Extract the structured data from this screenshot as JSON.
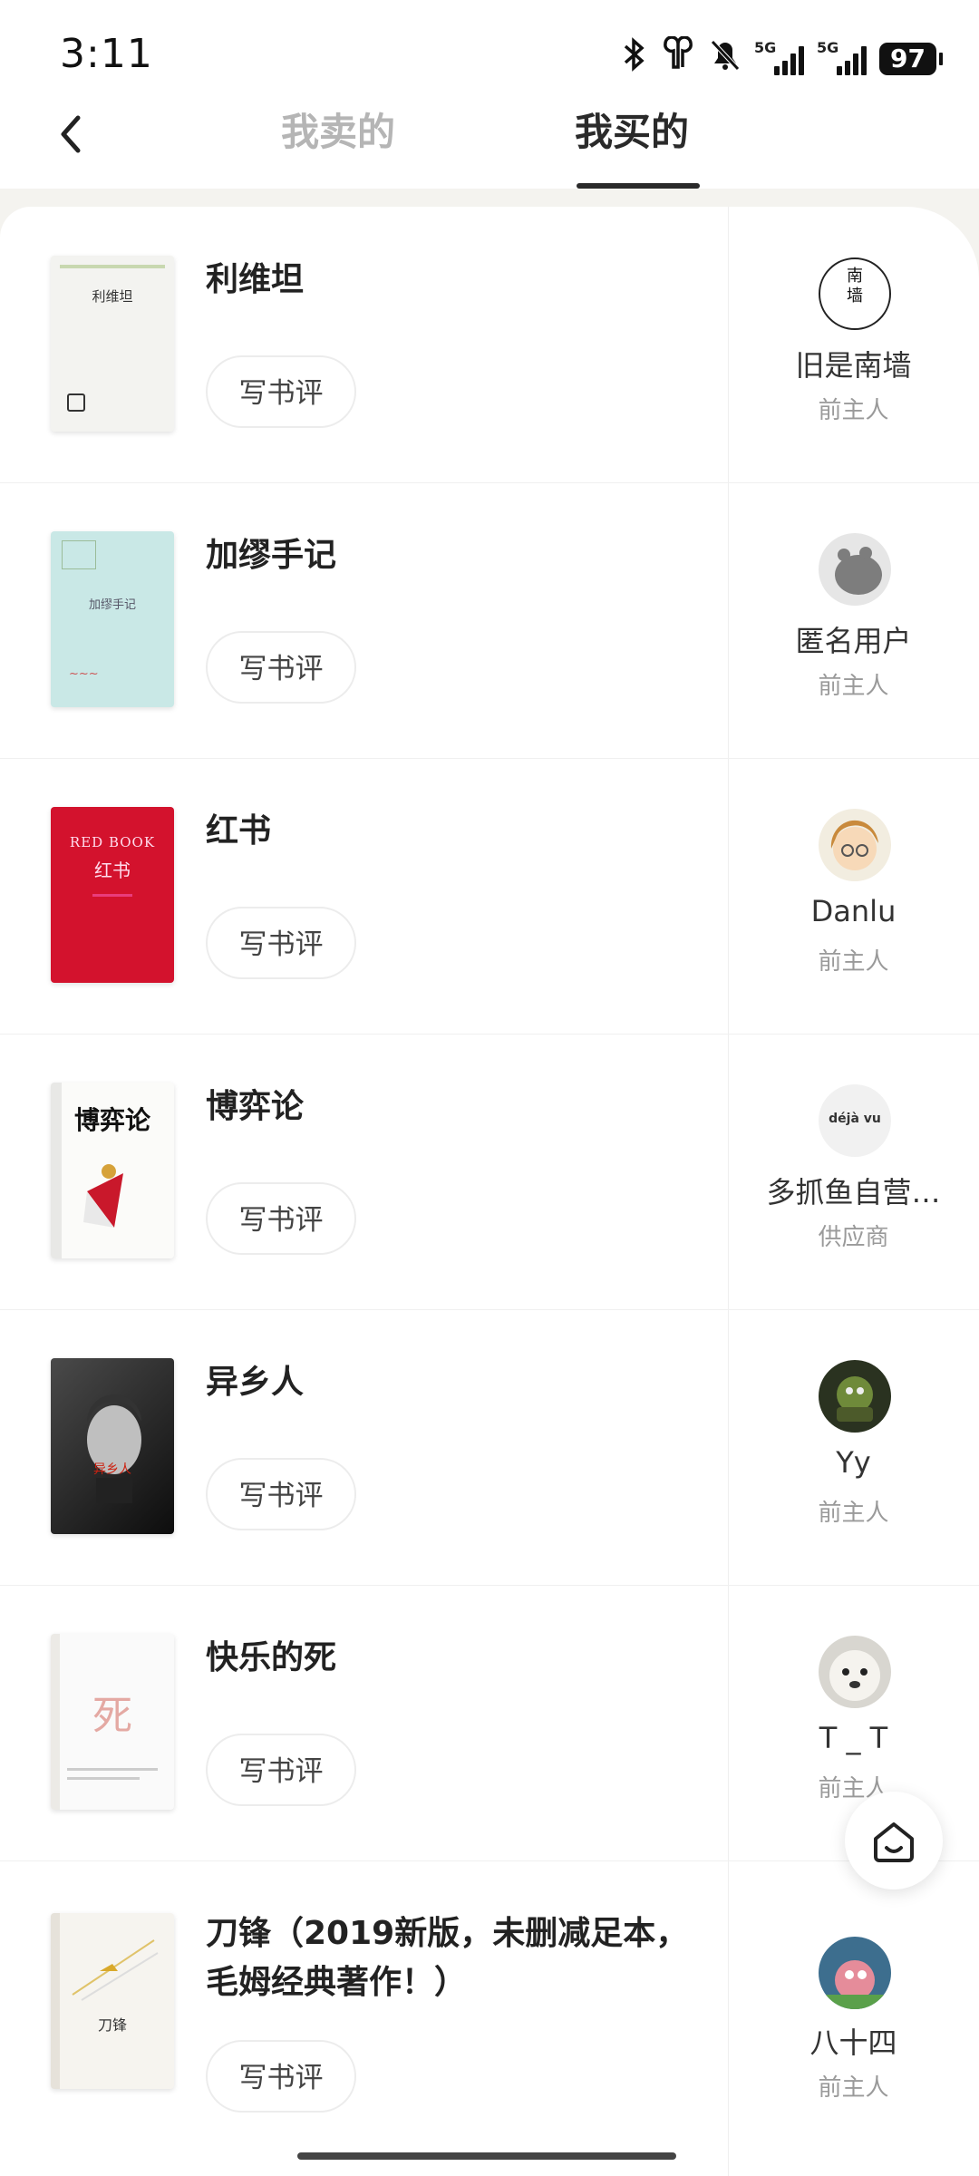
{
  "status": {
    "time": "3:11",
    "network_tag": "5G",
    "battery": "97"
  },
  "header": {
    "tab_sold": "我卖的",
    "tab_bought": "我买的"
  },
  "items": [
    {
      "title": "利维坦",
      "button": "写书评",
      "seller": "旧是南墙",
      "role": "前主人",
      "avatar_text": "南\n墙",
      "cover_text": "利维坦"
    },
    {
      "title": "加缪手记",
      "button": "写书评",
      "seller": "匿名用户",
      "role": "前主人",
      "cover_text": "加缪手记"
    },
    {
      "title": "红书",
      "button": "写书评",
      "seller": "Danlu",
      "role": "前主人",
      "cover_text": "RED BOOK",
      "cover_sub": "红书"
    },
    {
      "title": "博弈论",
      "button": "写书评",
      "seller": "多抓鱼自营…",
      "role": "供应商",
      "avatar_text": "déjà vu",
      "cover_text": "博弈论"
    },
    {
      "title": "异乡人",
      "button": "写书评",
      "seller": "Yy",
      "role": "前主人",
      "cover_text": "异乡人"
    },
    {
      "title": "快乐的死",
      "button": "写书评",
      "seller": "T _ T",
      "role": "前主人",
      "cover_text": "死"
    },
    {
      "title": "刀锋（2019新版，未删减足本，毛姆经典著作！）",
      "button": "写书评",
      "seller": "八十四",
      "role": "前主人",
      "cover_text": "刀锋"
    }
  ]
}
